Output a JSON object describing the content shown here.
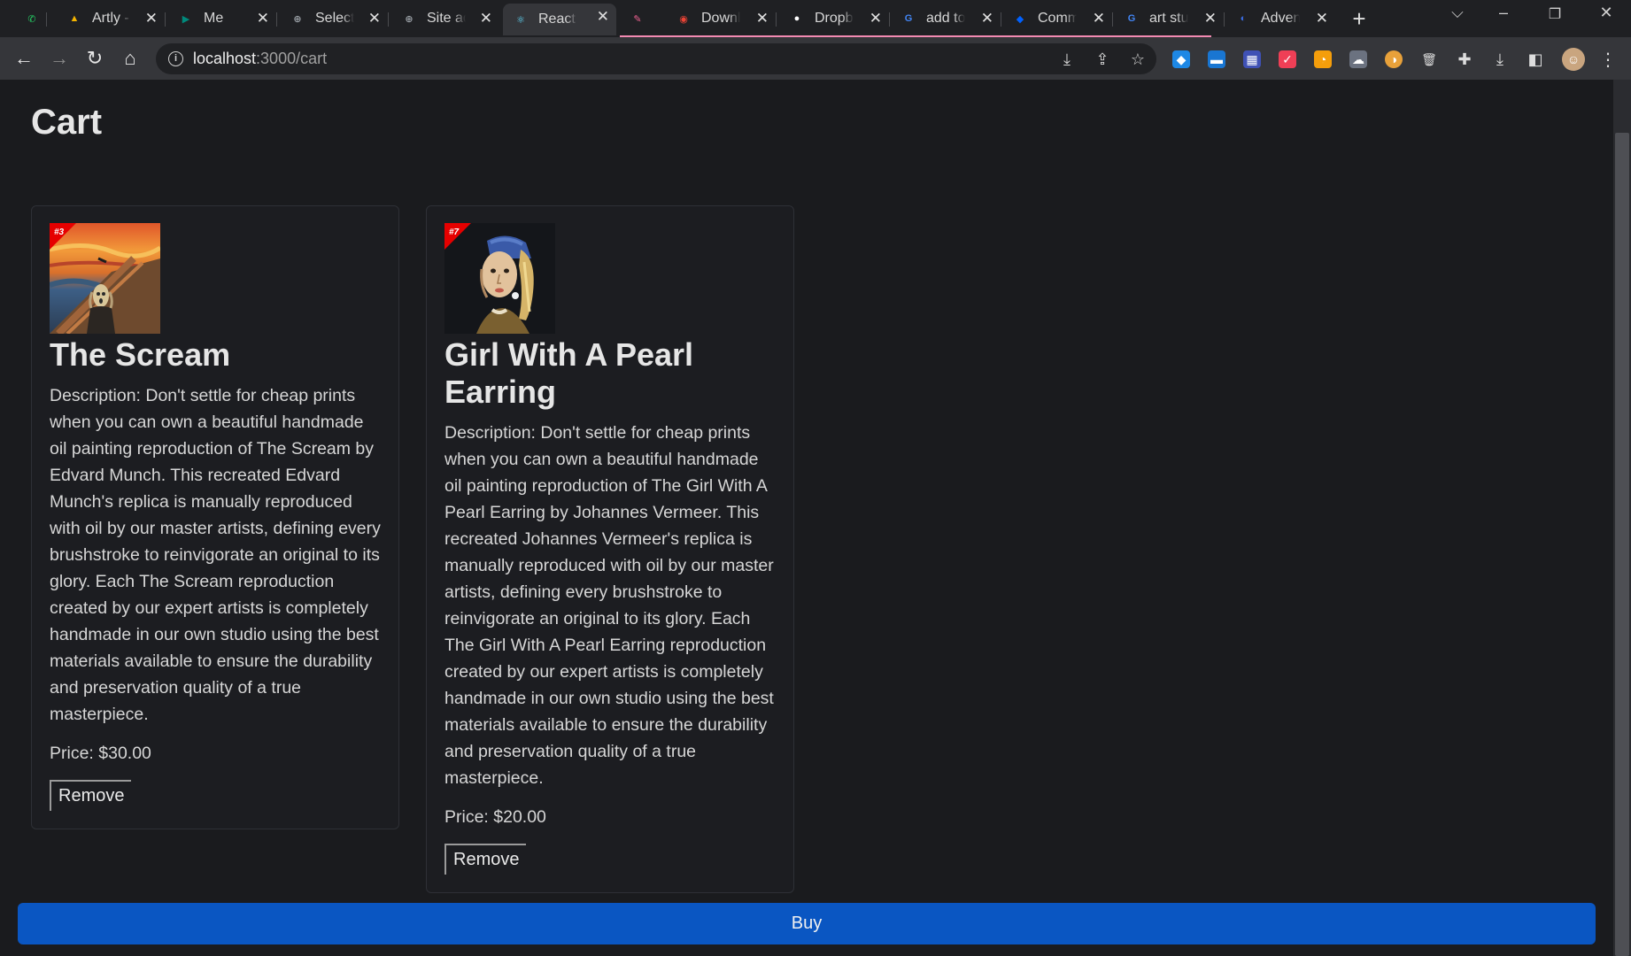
{
  "browser": {
    "tabs": [
      {
        "title": "",
        "icon": "whatsapp-icon",
        "color": "#25d366",
        "glyph": "✆"
      },
      {
        "title": "Artly -",
        "icon": "google-drive-icon",
        "color": "#f4b400",
        "glyph": "▲"
      },
      {
        "title": "Me",
        "icon": "google-meet-icon",
        "color": "#00897b",
        "glyph": "▶"
      },
      {
        "title": "Select",
        "icon": "globe-icon",
        "color": "#9aa0a6",
        "glyph": "⊕"
      },
      {
        "title": "Site ad",
        "icon": "globe-icon",
        "color": "#9aa0a6",
        "glyph": "⊕"
      },
      {
        "title": "React",
        "icon": "react-icon",
        "color": "#61dafb",
        "glyph": "⚛"
      },
      {
        "title": "",
        "icon": "rainbow-brush-icon",
        "color": "#f06292",
        "glyph": "✎"
      },
      {
        "title": "Downl",
        "icon": "chrome-icon",
        "color": "#ea4335",
        "glyph": "◉"
      },
      {
        "title": "Dropb",
        "icon": "github-icon",
        "color": "#ffffff",
        "glyph": "●"
      },
      {
        "title": "add to",
        "icon": "google-icon",
        "color": "#4285f4",
        "glyph": "G"
      },
      {
        "title": "Comm",
        "icon": "dropbox-icon",
        "color": "#0061fe",
        "glyph": "◆"
      },
      {
        "title": "art stu",
        "icon": "google-icon",
        "color": "#4285f4",
        "glyph": "G"
      },
      {
        "title": "Advent",
        "icon": "docs-icon",
        "color": "#3b6ee6",
        "glyph": "◐"
      }
    ],
    "url_host": "localhost",
    "url_path": ":3000/cart"
  },
  "page": {
    "title": "Cart",
    "buy_label": "Buy",
    "accent_color": "#0a56c2"
  },
  "cart_items": [
    {
      "badge": "#3",
      "title": "The Scream",
      "description": "Description: Don't settle for cheap prints when you can own a beautiful handmade oil painting reproduction of The Scream by Edvard Munch. This recreated Edvard Munch's replica is manually reproduced with oil by our master artists, defining every brushstroke to reinvigorate an original to its glory. Each The Scream reproduction created by our expert artists is completely handmade in our own studio using the best materials available to ensure the durability and preservation quality of a true masterpiece.",
      "price": "Price: $30.00",
      "remove_label": "Remove"
    },
    {
      "badge": "#7",
      "title": "Girl With A Pearl Earring",
      "description": "Description: Don't settle for cheap prints when you can own a beautiful handmade oil painting reproduction of The Girl With A Pearl Earring by Johannes Vermeer. This recreated Johannes Vermeer's replica is manually reproduced with oil by our master artists, defining every brushstroke to reinvigorate an original to its glory. Each The Girl With A Pearl Earring reproduction created by our expert artists is completely handmade in our own studio using the best materials available to ensure the durability and preservation quality of a true masterpiece.",
      "price": "Price: $20.00",
      "remove_label": "Remove"
    }
  ]
}
